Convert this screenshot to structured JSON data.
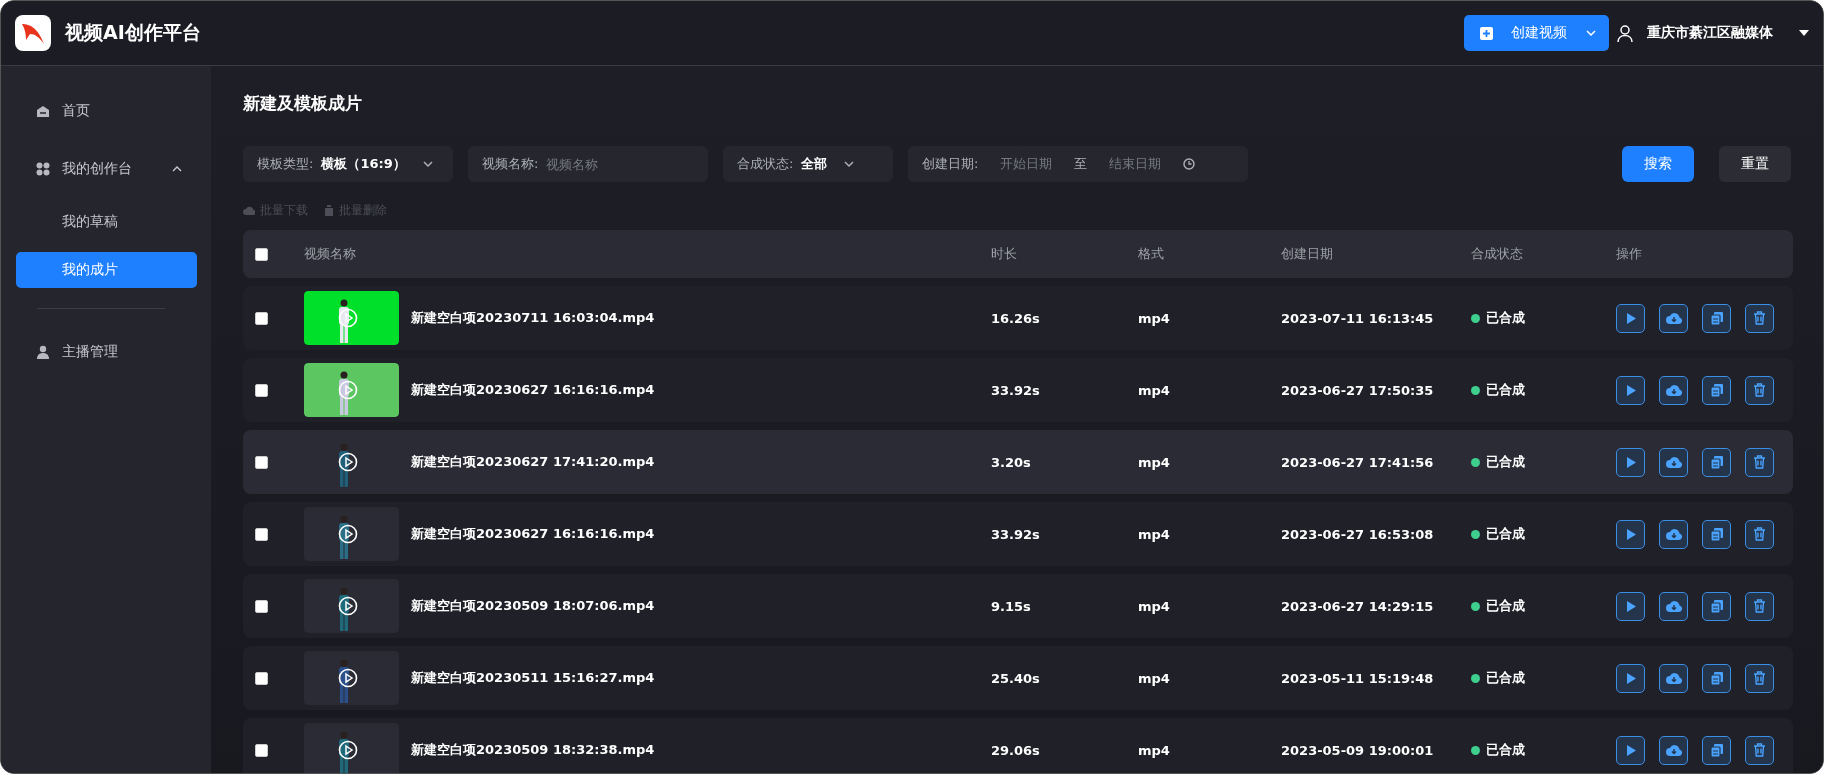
{
  "app": {
    "title": "视频AI创作平台"
  },
  "header": {
    "create_button": "创建视频",
    "user": "重庆市綦江区融媒体"
  },
  "sidebar": {
    "items": [
      {
        "label": "首页",
        "selected": false
      },
      {
        "label": "我的创作台",
        "selected": false,
        "expanded": true,
        "children": [
          {
            "label": "我的草稿",
            "selected": false
          },
          {
            "label": "我的成片",
            "selected": true
          }
        ]
      },
      {
        "label": "主播管理",
        "selected": false
      }
    ]
  },
  "page": {
    "title": "新建及模板成片"
  },
  "filters": [
    {
      "kind": "select",
      "label": "模板类型:",
      "value": "横板（16:9）"
    },
    {
      "kind": "input",
      "label": "视频名称:",
      "placeholder": "视频名称"
    },
    {
      "kind": "select",
      "label": "合成状态:",
      "value": "全部"
    },
    {
      "kind": "daterange",
      "label": "创建日期:",
      "start_placeholder": "开始日期",
      "separator": "至",
      "end_placeholder": "结束日期"
    }
  ],
  "buttons": {
    "search": "搜索",
    "reset": "重置"
  },
  "batch_actions": [
    {
      "label": "批量下载",
      "disabled": true
    },
    {
      "label": "批量删除",
      "disabled": true
    }
  ],
  "table": {
    "all_checked": false,
    "columns": [
      "视频名称",
      "时长",
      "格式",
      "创建日期",
      "合成状态",
      "操作"
    ],
    "rows": [
      {
        "checked": false,
        "hovered": false,
        "name": "新建空白项20230711 16:03:04.mp4",
        "duration": "16.26s",
        "format": "mp4",
        "created": "2023-07-11 16:13:45",
        "status": {
          "text": "已合成",
          "color": "#3ecf8e"
        }
      },
      {
        "checked": false,
        "hovered": false,
        "name": "新建空白项20230627 16:16:16.mp4",
        "duration": "33.92s",
        "format": "mp4",
        "created": "2023-06-27 17:50:35",
        "status": {
          "text": "已合成",
          "color": "#3ecf8e"
        }
      },
      {
        "checked": false,
        "hovered": true,
        "name": "新建空白项20230627 17:41:20.mp4",
        "duration": "3.20s",
        "format": "mp4",
        "created": "2023-06-27 17:41:56",
        "status": {
          "text": "已合成",
          "color": "#3ecf8e"
        }
      },
      {
        "checked": false,
        "hovered": false,
        "name": "新建空白项20230627 16:16:16.mp4",
        "duration": "33.92s",
        "format": "mp4",
        "created": "2023-06-27 16:53:08",
        "status": {
          "text": "已合成",
          "color": "#3ecf8e"
        }
      },
      {
        "checked": false,
        "hovered": false,
        "name": "新建空白项20230509 18:07:06.mp4",
        "duration": "9.15s",
        "format": "mp4",
        "created": "2023-06-27 14:29:15",
        "status": {
          "text": "已合成",
          "color": "#3ecf8e"
        }
      },
      {
        "checked": false,
        "hovered": false,
        "name": "新建空白项20230511 15:16:27.mp4",
        "duration": "25.40s",
        "format": "mp4",
        "created": "2023-05-11 15:19:48",
        "status": {
          "text": "已合成",
          "color": "#3ecf8e"
        }
      },
      {
        "checked": false,
        "hovered": false,
        "name": "新建空白项20230509 18:32:38.mp4",
        "duration": "29.06s",
        "format": "mp4",
        "created": "2023-05-09 19:00:01",
        "status": {
          "text": "已合成",
          "color": "#3ecf8e"
        }
      }
    ]
  }
}
